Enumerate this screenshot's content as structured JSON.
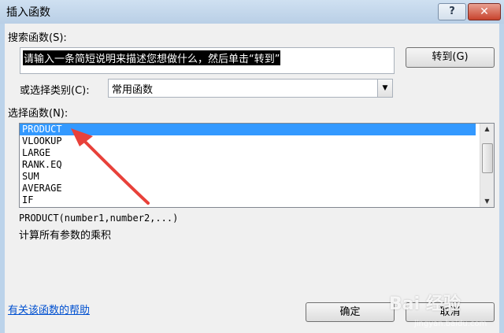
{
  "window": {
    "title": "插入函数",
    "help_button": "?",
    "close_button": "✕"
  },
  "search": {
    "label": "搜索函数(S):",
    "value": "请输入一条简短说明来描述您想做什么，然后单击“转到”",
    "go_button": "转到(G)"
  },
  "category": {
    "label": "或选择类别(C):",
    "selected": "常用函数"
  },
  "functions": {
    "label": "选择函数(N):",
    "items": [
      "PRODUCT",
      "VLOOKUP",
      "LARGE",
      "RANK.EQ",
      "SUM",
      "AVERAGE",
      "IF"
    ],
    "selected_index": 0,
    "signature": "PRODUCT(number1,number2,...)",
    "description": "计算所有参数的乘积"
  },
  "footer": {
    "help_link": "有关该函数的帮助",
    "ok_button": "确定",
    "cancel_button": "取消"
  },
  "watermark": {
    "brand": "Bai 经验",
    "sub": "jingyan.baidu.com"
  },
  "colors": {
    "selection": "#3399ff",
    "annotation_arrow": "#e8413a",
    "link": "#0050d0"
  }
}
